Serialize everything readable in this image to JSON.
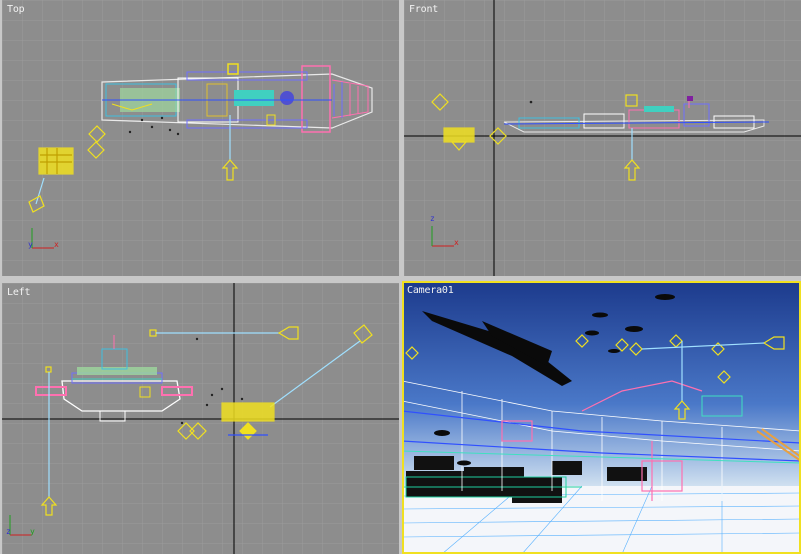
{
  "viewports": {
    "top": {
      "label": "Top"
    },
    "front": {
      "label": "Front"
    },
    "left": {
      "label": "Left"
    },
    "camera": {
      "label": "Camera01"
    }
  },
  "axis_labels": {
    "x": "x",
    "y": "y",
    "z": "z"
  },
  "colors": {
    "viewport_bg": "#8d8d8d",
    "grid": "#9b9b9b",
    "grid_axis": "#000000",
    "selection_yellow": "#f0e020",
    "active_frame": "#f0e020",
    "sky_top": "#1c3a8c",
    "sky_bottom": "#cfe0f0"
  }
}
